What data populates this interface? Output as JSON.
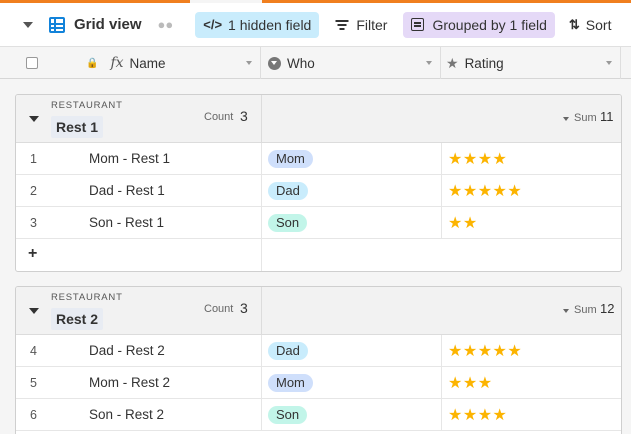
{
  "toolbar": {
    "view_name": "Grid view",
    "hidden_label": "1 hidden field",
    "filter_label": "Filter",
    "grouped_label": "Grouped by 1 field",
    "sort_label": "Sort"
  },
  "columns": {
    "name": "Name",
    "who": "Who",
    "rating": "Rating"
  },
  "colors": {
    "accent": "#f07f1f",
    "star": "#fcb400",
    "Mom": "#cfdffb",
    "Dad": "#c9ecfc",
    "Son": "#c2f5e9"
  },
  "groups": [
    {
      "field_label": "RESTAURANT",
      "value": "Rest 1",
      "count_label": "Count",
      "count": "3",
      "sum_label": "Sum",
      "sum": "11",
      "rows": [
        {
          "num": "1",
          "name": "Mom - Rest 1",
          "who": "Mom",
          "rating": 4
        },
        {
          "num": "2",
          "name": "Dad - Rest 1",
          "who": "Dad",
          "rating": 5
        },
        {
          "num": "3",
          "name": "Son - Rest 1",
          "who": "Son",
          "rating": 2
        }
      ],
      "add_label": "+"
    },
    {
      "field_label": "RESTAURANT",
      "value": "Rest 2",
      "count_label": "Count",
      "count": "3",
      "sum_label": "Sum",
      "sum": "12",
      "rows": [
        {
          "num": "4",
          "name": "Dad - Rest 2",
          "who": "Dad",
          "rating": 5
        },
        {
          "num": "5",
          "name": "Mom - Rest 2",
          "who": "Mom",
          "rating": 3
        },
        {
          "num": "6",
          "name": "Son - Rest 2",
          "who": "Son",
          "rating": 4
        }
      ]
    }
  ]
}
